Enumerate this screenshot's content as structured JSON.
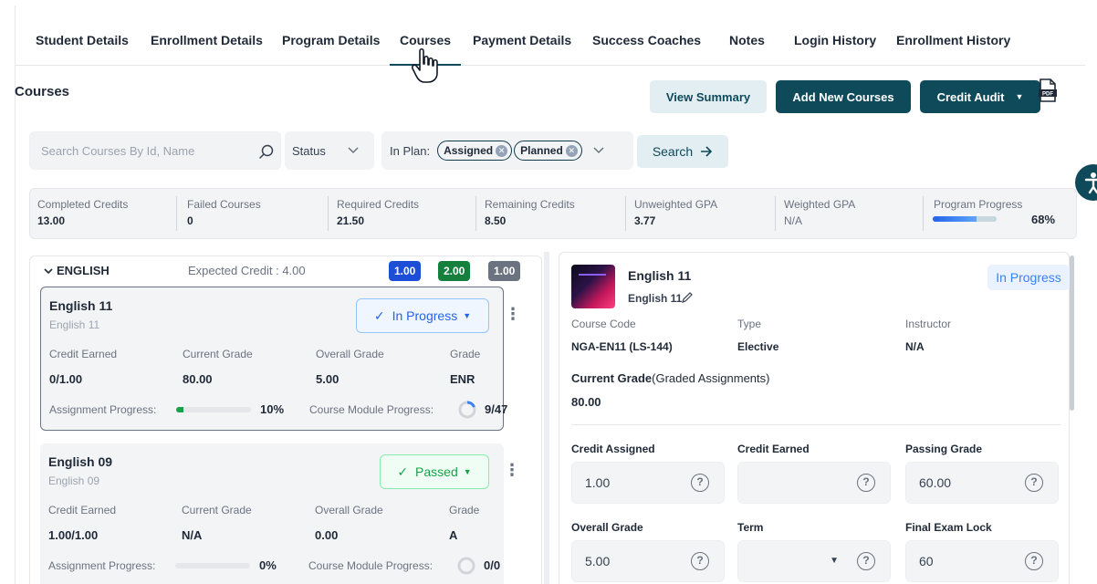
{
  "tabs": [
    {
      "label": "Student Details"
    },
    {
      "label": "Enrollment Details"
    },
    {
      "label": "Program Details"
    },
    {
      "label": "Courses"
    },
    {
      "label": "Payment Details"
    },
    {
      "label": "Success Coaches"
    },
    {
      "label": "Notes"
    },
    {
      "label": "Login History"
    },
    {
      "label": "Enrollment History"
    }
  ],
  "active_tab": "Courses",
  "header": {
    "title": "Courses",
    "view_summary": "View Summary",
    "add_new_courses": "Add New Courses",
    "credit_audit": "Credit Audit",
    "pdf_label": "PDF"
  },
  "filters": {
    "search_placeholder": "Search Courses By Id, Name",
    "status_label": "Status",
    "in_plan_label": "In Plan:",
    "chips": [
      "Assigned",
      "Planned"
    ],
    "search_button": "Search"
  },
  "stats": [
    {
      "label": "Completed Credits",
      "value": "13.00"
    },
    {
      "label": "Failed Courses",
      "value": "0"
    },
    {
      "label": "Required Credits",
      "value": "21.50"
    },
    {
      "label": "Remaining Credits",
      "value": "8.50"
    },
    {
      "label": "Unweighted GPA",
      "value": "3.77"
    },
    {
      "label": "Weighted GPA",
      "value": "N/A"
    },
    {
      "label": "Program Progress",
      "value": "68%",
      "fraction": 0.68
    }
  ],
  "group": {
    "name": "ENGLISH",
    "expected_credit": "Expected Credit : 4.00",
    "pills": [
      {
        "value": "1.00",
        "color": "#1d4ed8"
      },
      {
        "value": "2.00",
        "color": "#15803d"
      },
      {
        "value": "1.00",
        "color": "#6b7280"
      }
    ]
  },
  "courses": [
    {
      "title": "English 11",
      "subtitle": "English 11",
      "status": "In Progress",
      "labels": {
        "credit_earned": "Credit Earned",
        "current_grade": "Current Grade",
        "overall_grade": "Overall Grade",
        "grade": "Grade"
      },
      "credit_earned": "0/1.00",
      "current_grade": "80.00",
      "overall_grade": "5.00",
      "grade": "ENR",
      "assignment_progress_label": "Assignment Progress:",
      "assignment_progress": "10%",
      "assignment_fraction": 0.1,
      "module_progress_label": "Course Module Progress:",
      "module_progress": "9/47",
      "module_fraction": 0.19
    },
    {
      "title": "English 09",
      "subtitle": "English 09",
      "status": "Passed",
      "labels": {
        "credit_earned": "Credit Earned",
        "current_grade": "Current Grade",
        "overall_grade": "Overall Grade",
        "grade": "Grade"
      },
      "credit_earned": "1.00/1.00",
      "current_grade": "N/A",
      "overall_grade": "0.00",
      "grade": "A",
      "assignment_progress_label": "Assignment Progress:",
      "assignment_progress": "0%",
      "assignment_fraction": 0,
      "module_progress_label": "Course Module Progress:",
      "module_progress": "0/0",
      "module_fraction": 0
    }
  ],
  "detail": {
    "title": "English 11",
    "subtitle": "English 11",
    "status": "In Progress",
    "course_code_label": "Course Code",
    "course_code": "NGA-EN11 (LS-144)",
    "type_label": "Type",
    "type": "Elective",
    "instructor_label": "Instructor",
    "instructor": "N/A",
    "current_grade_label": "Current Grade",
    "current_grade_note": "(Graded Assignments)",
    "current_grade": "80.00",
    "fields": [
      {
        "label": "Credit Assigned",
        "value": "1.00"
      },
      {
        "label": "Credit Earned",
        "value": ""
      },
      {
        "label": "Passing Grade",
        "value": "60.00"
      },
      {
        "label": "Overall Grade",
        "value": "5.00"
      },
      {
        "label": "Term",
        "value": ""
      },
      {
        "label": "Final Exam Lock",
        "value": "60"
      }
    ],
    "help_glyph": "?"
  },
  "colors": {
    "primary": "#0f4a5a",
    "in_progress": "#2563eb",
    "passed": "#16a34a"
  }
}
